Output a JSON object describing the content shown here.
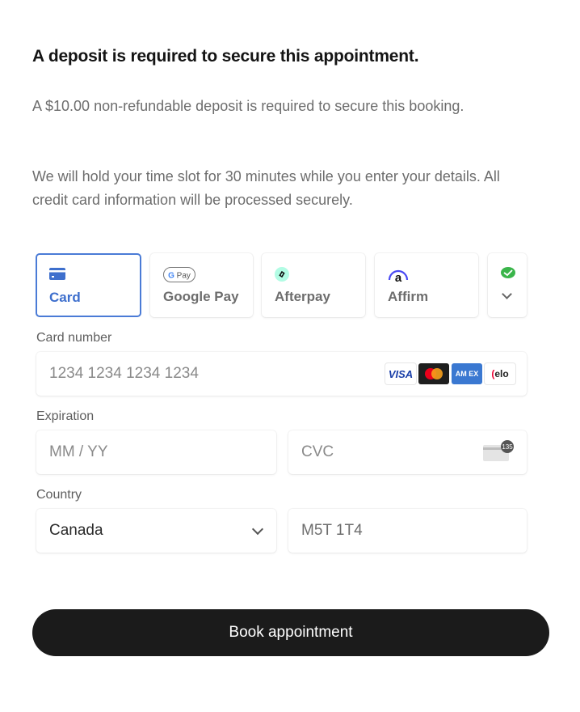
{
  "header": {
    "title": "A deposit is required to secure this appointment."
  },
  "body": {
    "deposit_text": "A $10.00 non-refundable deposit is required to secure this booking.",
    "hold_text": "We will hold your time slot for 30 minutes while you enter your details. All credit card information will be processed securely."
  },
  "payment_methods": {
    "selected": "Card",
    "accent_color": "#3e6fcd",
    "tabs": [
      {
        "label": "Card",
        "icon": "credit-card-icon"
      },
      {
        "label": "Google Pay",
        "icon": "google-pay-icon",
        "icon_text": "G Pay"
      },
      {
        "label": "Afterpay",
        "icon": "afterpay-icon"
      },
      {
        "label": "Affirm",
        "icon": "affirm-icon",
        "icon_text": "a"
      },
      {
        "label": "",
        "icon": "wechat-pay-icon"
      }
    ]
  },
  "form": {
    "card_number": {
      "label": "Card number",
      "placeholder": "1234 1234 1234 1234",
      "brands": [
        {
          "name": "visa",
          "text": "VISA"
        },
        {
          "name": "mastercard",
          "text": ""
        },
        {
          "name": "amex",
          "text": "AM EX"
        },
        {
          "name": "elo",
          "text": "elo"
        }
      ]
    },
    "expiration": {
      "label": "Expiration",
      "placeholder": "MM / YY"
    },
    "cvc": {
      "placeholder": "CVC",
      "icon_text": "135"
    },
    "country": {
      "label": "Country",
      "value": "Canada"
    },
    "postal": {
      "value": "M5T 1T4"
    }
  },
  "actions": {
    "book_label": "Book appointment"
  }
}
